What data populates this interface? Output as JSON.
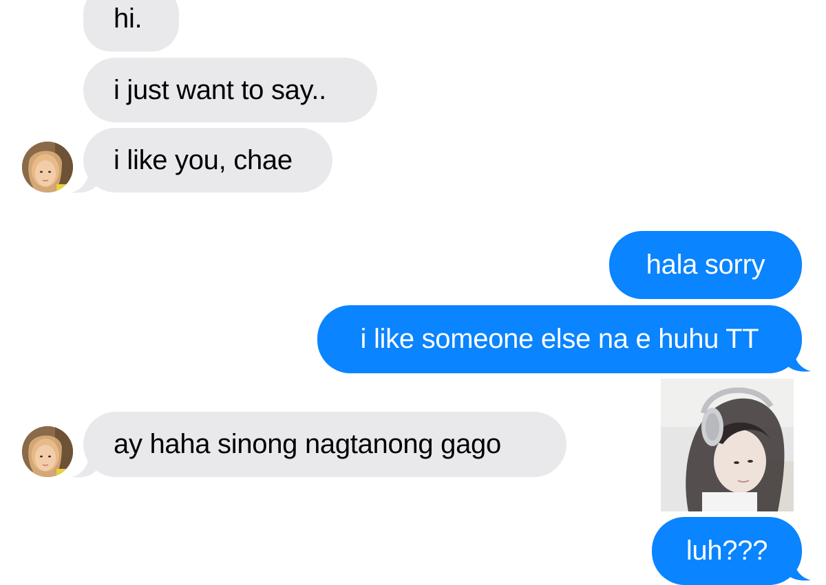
{
  "messages": {
    "incoming_1": "hi.",
    "incoming_2": "i just want to say..",
    "incoming_3": "i like you, chae",
    "outgoing_1": "hala sorry",
    "outgoing_2": "i like someone else na e huhu TT",
    "incoming_4": "ay haha sinong nagtanong gago",
    "outgoing_3": "luh???"
  },
  "colors": {
    "incoming_bubble": "#e9e9eb",
    "outgoing_bubble": "#0a84ff",
    "incoming_text": "#000000",
    "outgoing_text": "#ffffff"
  },
  "icons": {
    "contact_avatar": "contact-avatar",
    "shared_photo": "photo-attachment"
  }
}
